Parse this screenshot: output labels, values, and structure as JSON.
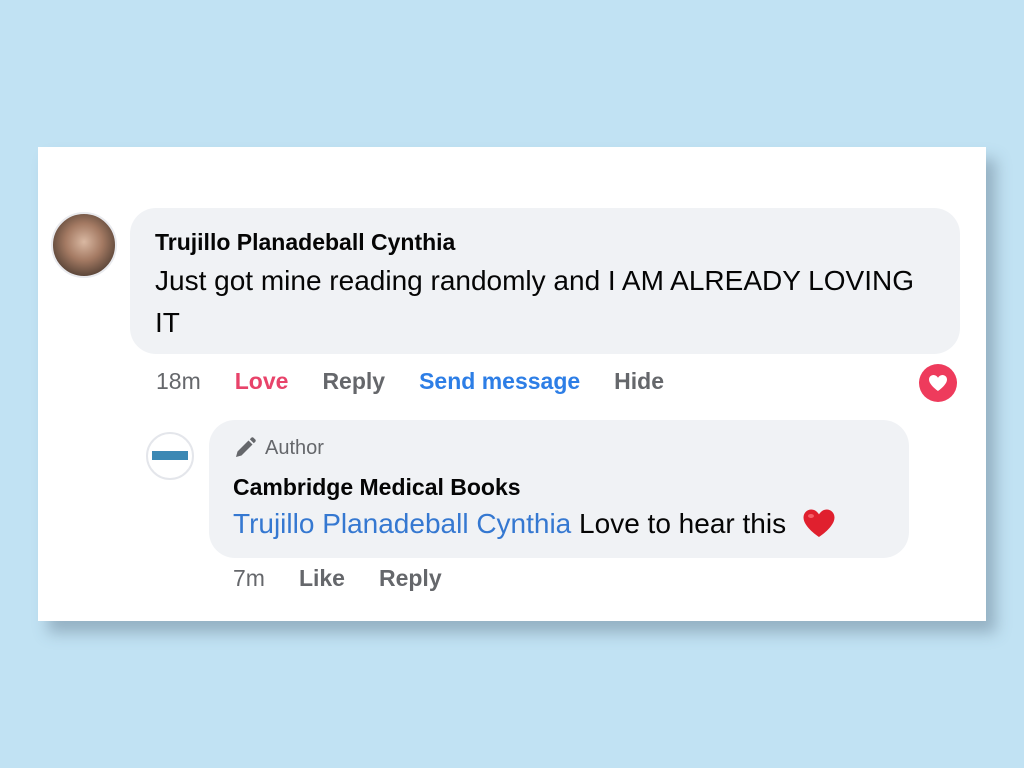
{
  "comment": {
    "author_name": "Trujillo Planadeball Cynthia",
    "text": "Just got mine reading randomly and I AM ALREADY LOVING IT",
    "actions": {
      "time": "18m",
      "love": "Love",
      "reply": "Reply",
      "send_message": "Send message",
      "hide": "Hide"
    },
    "reaction_icon": "heart-reaction-icon",
    "colors": {
      "love": "#e8436a",
      "send_message": "#2d7ee6",
      "reaction_badge": "#ee3b5c"
    }
  },
  "reply": {
    "badge": "Author",
    "badge_icon": "pencil-icon",
    "author_name": "Cambridge Medical Books",
    "mention": "Trujillo Planadeball Cynthia",
    "text": "Love to hear this",
    "emoji_icon": "red-heart-emoji-icon",
    "actions": {
      "time": "7m",
      "like": "Like",
      "reply": "Reply"
    },
    "colors": {
      "mention": "#3578d1"
    }
  },
  "colors": {
    "background": "#c1e2f3",
    "bubble": "#f0f2f5",
    "muted_text": "#65676b"
  }
}
